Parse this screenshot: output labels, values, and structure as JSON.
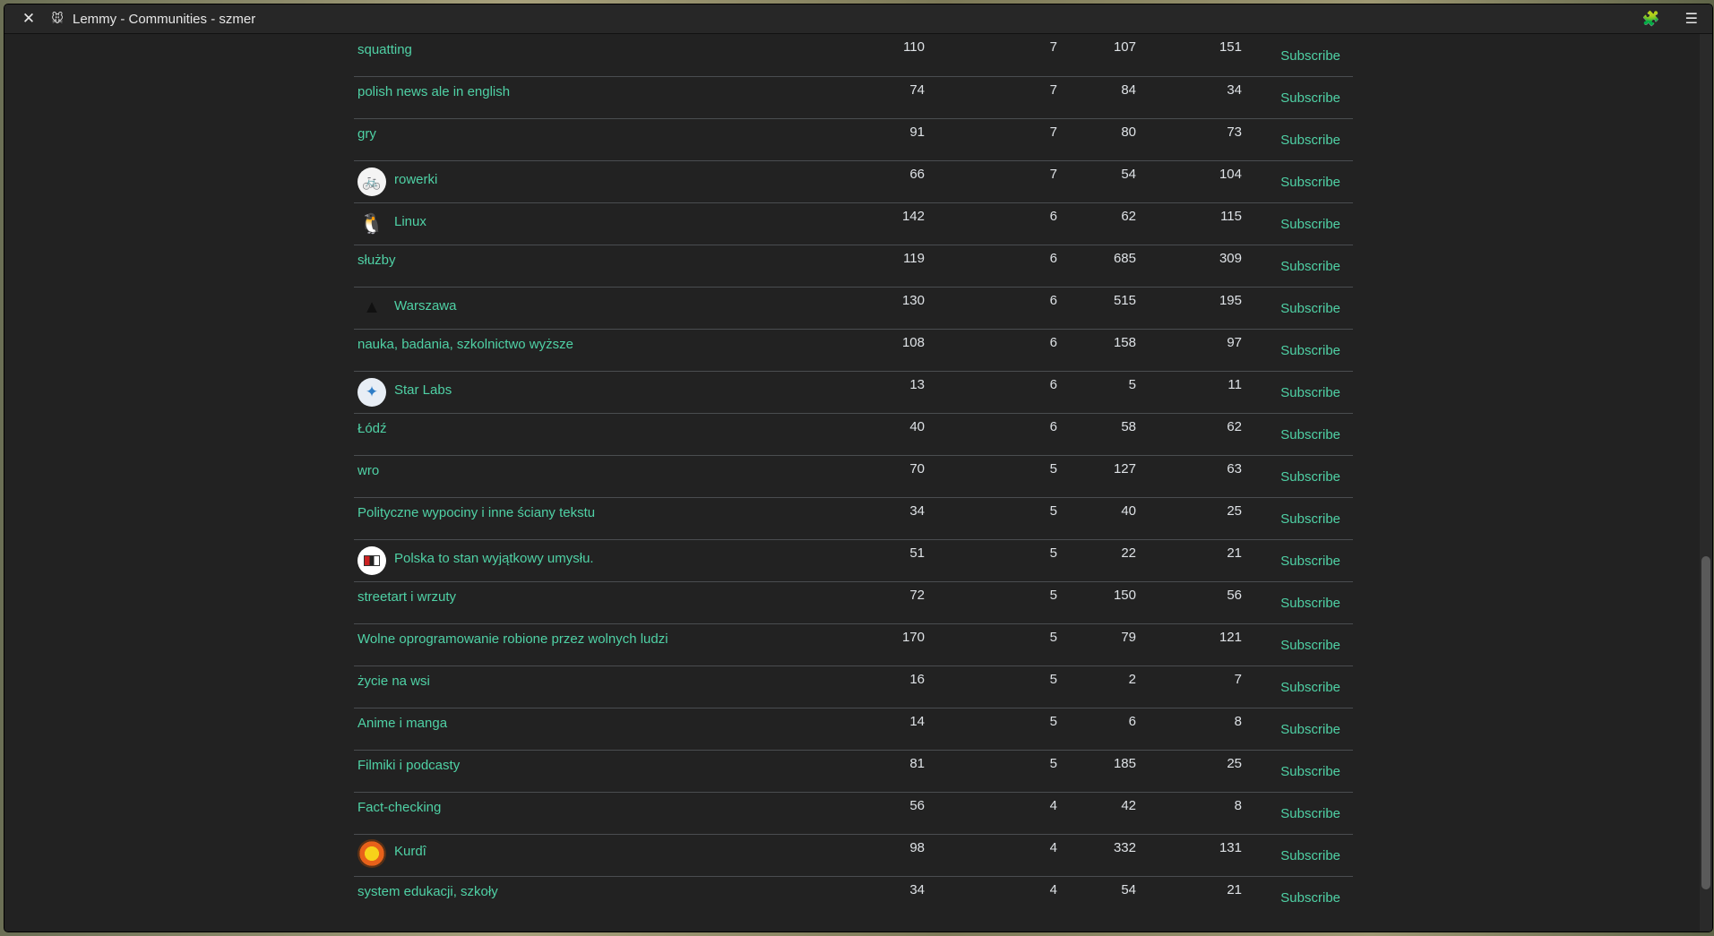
{
  "window": {
    "title": "Lemmy - Communities - szmer",
    "close_glyph": "✕",
    "favicon": "🐭",
    "extensions_glyph": "🧩",
    "menu_glyph": "☰"
  },
  "subscribe_label": "Subscribe",
  "communities": [
    {
      "name": "squatting",
      "icon": null,
      "c1": "110",
      "c2": "7",
      "c3": "107",
      "c4": "151"
    },
    {
      "name": "polish news ale in english",
      "icon": null,
      "c1": "74",
      "c2": "7",
      "c3": "84",
      "c4": "34"
    },
    {
      "name": "gry",
      "icon": null,
      "c1": "91",
      "c2": "7",
      "c3": "80",
      "c4": "73"
    },
    {
      "name": "rowerki",
      "icon": "bicycle-icon",
      "c1": "66",
      "c2": "7",
      "c3": "54",
      "c4": "104"
    },
    {
      "name": "Linux",
      "icon": "tux-penguin-icon",
      "c1": "142",
      "c2": "6",
      "c3": "62",
      "c4": "115"
    },
    {
      "name": "służby",
      "icon": null,
      "c1": "119",
      "c2": "6",
      "c3": "685",
      "c4": "309"
    },
    {
      "name": "Warszawa",
      "icon": "palace-of-culture-icon",
      "c1": "130",
      "c2": "6",
      "c3": "515",
      "c4": "195"
    },
    {
      "name": "nauka, badania, szkolnictwo wyższe",
      "icon": null,
      "c1": "108",
      "c2": "6",
      "c3": "158",
      "c4": "97"
    },
    {
      "name": "Star Labs",
      "icon": "star-labs-logo-icon",
      "c1": "13",
      "c2": "6",
      "c3": "5",
      "c4": "11"
    },
    {
      "name": "Łódź",
      "icon": null,
      "c1": "40",
      "c2": "6",
      "c3": "58",
      "c4": "62"
    },
    {
      "name": "wro",
      "icon": null,
      "c1": "70",
      "c2": "5",
      "c3": "127",
      "c4": "63"
    },
    {
      "name": "Polityczne wypociny i inne ściany tekstu",
      "icon": null,
      "c1": "34",
      "c2": "5",
      "c3": "40",
      "c4": "25"
    },
    {
      "name": "Polska to stan wyjątkowy umysłu.",
      "icon": "flag-icon",
      "c1": "51",
      "c2": "5",
      "c3": "22",
      "c4": "21"
    },
    {
      "name": "streetart i wrzuty",
      "icon": null,
      "c1": "72",
      "c2": "5",
      "c3": "150",
      "c4": "56"
    },
    {
      "name": "Wolne oprogramowanie robione przez wolnych ludzi",
      "icon": null,
      "c1": "170",
      "c2": "5",
      "c3": "79",
      "c4": "121"
    },
    {
      "name": "życie na wsi",
      "icon": null,
      "c1": "16",
      "c2": "5",
      "c3": "2",
      "c4": "7"
    },
    {
      "name": "Anime i manga",
      "icon": null,
      "c1": "14",
      "c2": "5",
      "c3": "6",
      "c4": "8"
    },
    {
      "name": "Filmiki i podcasty",
      "icon": null,
      "c1": "81",
      "c2": "5",
      "c3": "185",
      "c4": "25"
    },
    {
      "name": "Fact-checking",
      "icon": null,
      "c1": "56",
      "c2": "4",
      "c3": "42",
      "c4": "8"
    },
    {
      "name": "Kurdî",
      "icon": "kurdish-sun-icon",
      "c1": "98",
      "c2": "4",
      "c3": "332",
      "c4": "131"
    },
    {
      "name": "system edukacji, szkoły",
      "icon": null,
      "c1": "34",
      "c2": "4",
      "c3": "54",
      "c4": "21"
    }
  ]
}
